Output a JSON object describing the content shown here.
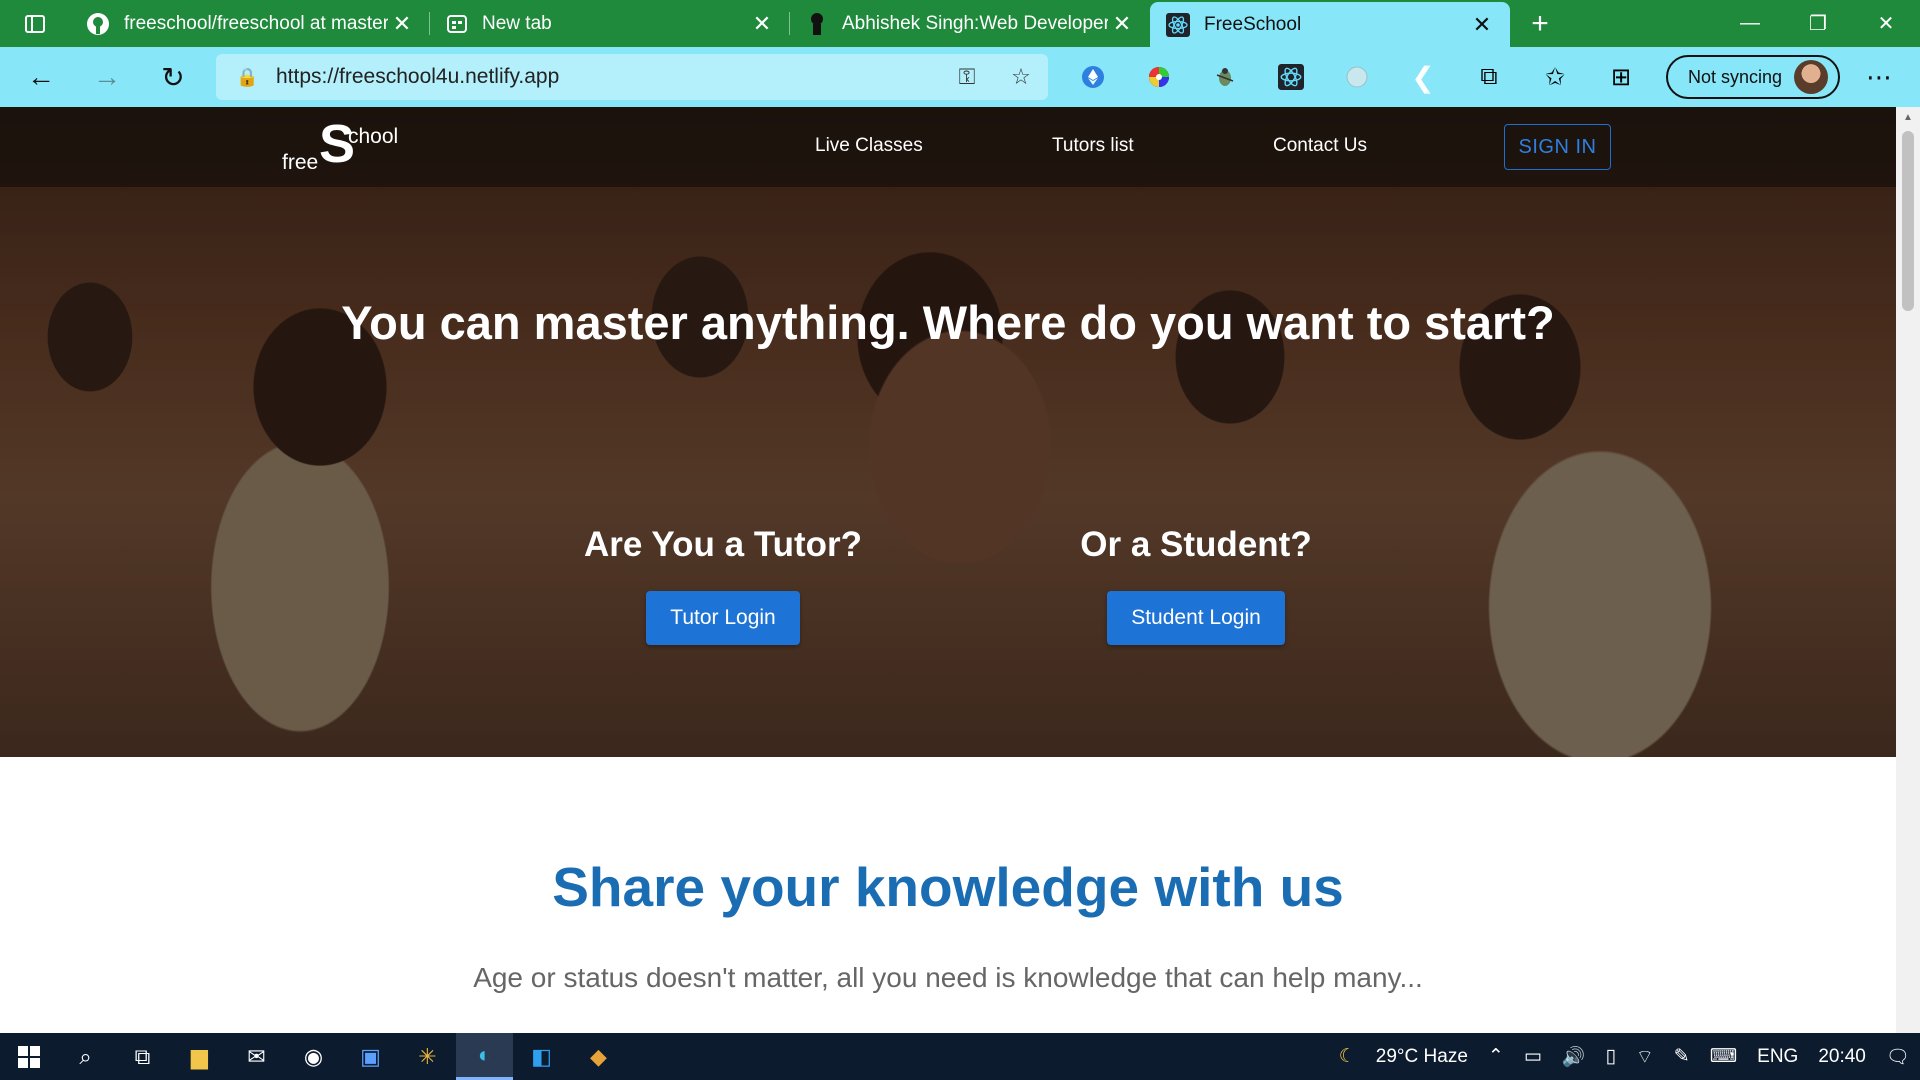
{
  "browser": {
    "tabs": [
      {
        "title": "freeschool/freeschool at master",
        "icon": "github-icon",
        "active": false
      },
      {
        "title": "New tab",
        "icon": "newtab-icon",
        "active": false
      },
      {
        "title": "Abhishek Singh:Web Developer",
        "icon": "profile-icon",
        "active": false
      },
      {
        "title": "FreeSchool",
        "icon": "react-icon",
        "active": true
      }
    ],
    "url": "https://freeschool4u.netlify.app",
    "sync_label": "Not syncing",
    "colors": {
      "tabstrip": "#1f8a3c",
      "toolbar": "#87e6f8"
    }
  },
  "site": {
    "logo": {
      "free": "free",
      "s": "S",
      "chool": "chool"
    },
    "nav": [
      "Live Classes",
      "Tutors list",
      "Contact Us"
    ],
    "signin": "SIGN IN",
    "hero_title": "You can master anything. Where do you want to start?",
    "tutor": {
      "heading": "Are You a Tutor?",
      "button": "Tutor Login"
    },
    "student": {
      "heading": "Or a Student?",
      "button": "Student Login"
    },
    "share_title": "Share your knowledge with us",
    "share_sub": "Age or status doesn't matter, all you need is knowledge that can help many...",
    "colors": {
      "primary": "#1e74d6",
      "heading_blue": "#1a6cb3"
    }
  },
  "taskbar": {
    "weather": "29°C  Haze",
    "lang": "ENG",
    "time": "20:40"
  }
}
